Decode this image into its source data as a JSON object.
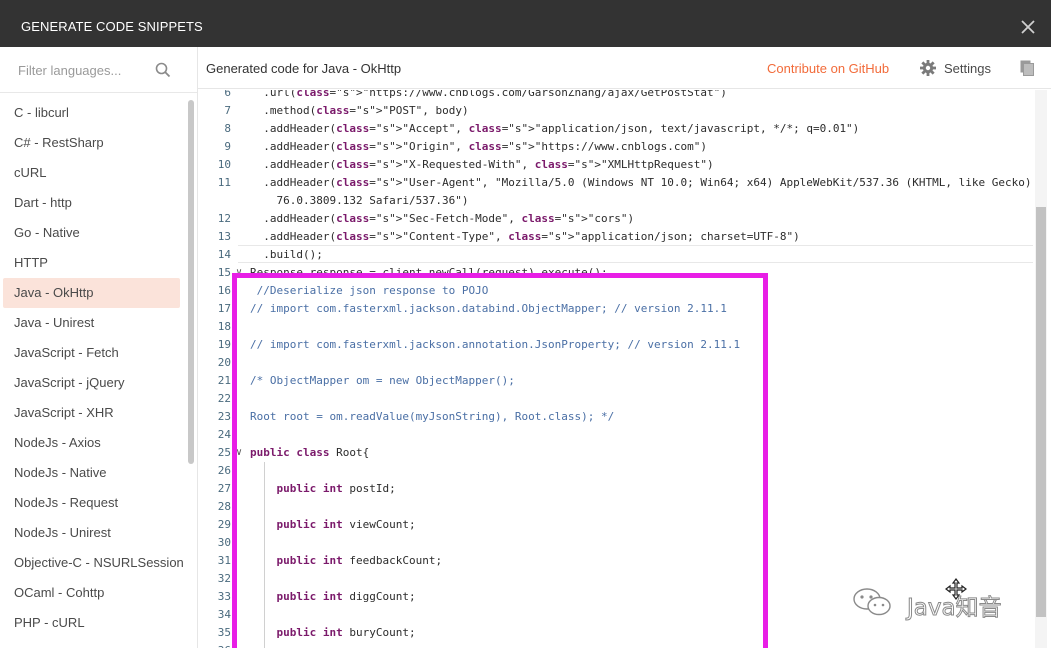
{
  "dialog": {
    "title": "GENERATE CODE SNIPPETS",
    "close_icon": "close-icon"
  },
  "sidebar": {
    "filter_placeholder": "Filter languages...",
    "search_icon": "search-icon",
    "items": [
      {
        "label": "C - libcurl"
      },
      {
        "label": "C# - RestSharp"
      },
      {
        "label": "cURL"
      },
      {
        "label": "Dart - http"
      },
      {
        "label": "Go - Native"
      },
      {
        "label": "HTTP"
      },
      {
        "label": "Java - OkHttp",
        "active": true
      },
      {
        "label": "Java - Unirest"
      },
      {
        "label": "JavaScript - Fetch"
      },
      {
        "label": "JavaScript - jQuery"
      },
      {
        "label": "JavaScript - XHR"
      },
      {
        "label": "NodeJs - Axios"
      },
      {
        "label": "NodeJs - Native"
      },
      {
        "label": "NodeJs - Request"
      },
      {
        "label": "NodeJs - Unirest"
      },
      {
        "label": "Objective-C - NSURLSession"
      },
      {
        "label": "OCaml - Cohttp"
      },
      {
        "label": "PHP - cURL"
      }
    ]
  },
  "header": {
    "generated_title": "Generated code for Java - OkHttp",
    "contribute_label": "Contribute on GitHub",
    "settings_label": "Settings",
    "settings_icon": "gear-icon",
    "copy_icon": "copy-icon"
  },
  "code": {
    "lines": [
      {
        "n": "6",
        "text": "  .url(\"https://www.cnblogs.com/GarsonZhang/ajax/GetPostStat\")"
      },
      {
        "n": "7",
        "text": "  .method(\"POST\", body)"
      },
      {
        "n": "8",
        "text": "  .addHeader(\"Accept\", \"application/json, text/javascript, */*; q=0.01\")"
      },
      {
        "n": "9",
        "text": "  .addHeader(\"Origin\", \"https://www.cnblogs.com\")"
      },
      {
        "n": "10",
        "text": "  .addHeader(\"X-Requested-With\", \"XMLHttpRequest\")"
      },
      {
        "n": "11",
        "text": "  .addHeader(\"User-Agent\", \"Mozilla/5.0 (Windows NT 10.0; Win64; x64) AppleWebKit/537.36 (KHTML, like Gecko) Chrome/"
      },
      {
        "n": "",
        "text": "    76.0.3809.132 Safari/537.36\")"
      },
      {
        "n": "12",
        "text": "  .addHeader(\"Sec-Fetch-Mode\", \"cors\")"
      },
      {
        "n": "13",
        "text": "  .addHeader(\"Content-Type\", \"application/json; charset=UTF-8\")"
      },
      {
        "n": "14",
        "text": "  .build();"
      },
      {
        "n": "15",
        "text": "Response response = client.newCall(request).execute();"
      },
      {
        "n": "16",
        "text": " //Deserialize json response to POJO"
      },
      {
        "n": "17",
        "text": "// import com.fasterxml.jackson.databind.ObjectMapper; // version 2.11.1"
      },
      {
        "n": "18",
        "text": ""
      },
      {
        "n": "19",
        "text": "// import com.fasterxml.jackson.annotation.JsonProperty; // version 2.11.1"
      },
      {
        "n": "20",
        "text": ""
      },
      {
        "n": "21",
        "text": "/* ObjectMapper om = new ObjectMapper();"
      },
      {
        "n": "22",
        "text": ""
      },
      {
        "n": "23",
        "text": "Root root = om.readValue(myJsonString), Root.class); */"
      },
      {
        "n": "24",
        "text": ""
      },
      {
        "n": "25",
        "text": "public class Root{"
      },
      {
        "n": "26",
        "text": ""
      },
      {
        "n": "27",
        "text": "    public int postId;"
      },
      {
        "n": "28",
        "text": ""
      },
      {
        "n": "29",
        "text": "    public int viewCount;"
      },
      {
        "n": "30",
        "text": ""
      },
      {
        "n": "31",
        "text": "    public int feedbackCount;"
      },
      {
        "n": "32",
        "text": ""
      },
      {
        "n": "33",
        "text": "    public int diggCount;"
      },
      {
        "n": "34",
        "text": ""
      },
      {
        "n": "35",
        "text": "    public int buryCount;"
      },
      {
        "n": "36",
        "text": ""
      }
    ]
  },
  "watermark": {
    "text": "Java知音",
    "icon": "wechat-icon"
  },
  "colors": {
    "titlebar": "#333333",
    "accent": "#f26b3a",
    "active_item": "#fbe3da",
    "highlight_box": "#e81ee6"
  }
}
